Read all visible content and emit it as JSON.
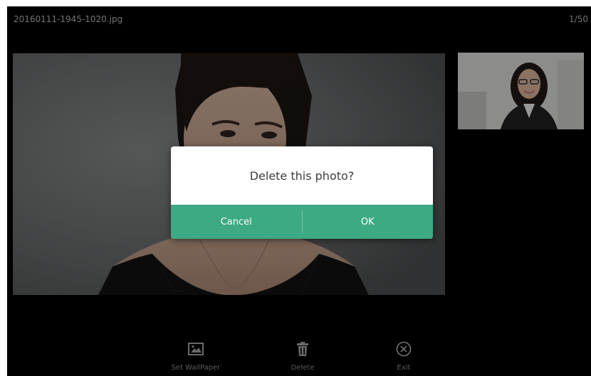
{
  "header": {
    "filename": "20160111-1945-1020.jpg",
    "pager": "1/50"
  },
  "main_photo": {
    "icon": "photo-portrait"
  },
  "thumbnail": {
    "icon": "photo-thumbnail"
  },
  "dialog": {
    "message": "Delete this photo?",
    "cancel_label": "Cancel",
    "ok_label": "OK",
    "accent_color": "#3eaa84"
  },
  "toolbar": {
    "items": [
      {
        "label": "Set WallPaper",
        "icon": "image-icon"
      },
      {
        "label": "Delete",
        "icon": "trash-icon"
      },
      {
        "label": "Exit",
        "icon": "close-circle-icon"
      }
    ]
  }
}
